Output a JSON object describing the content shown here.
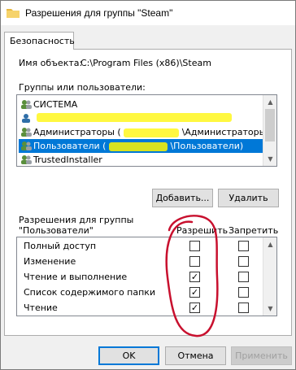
{
  "window": {
    "title": "Разрешения для группы \"Steam\""
  },
  "tabs": [
    {
      "label": "Безопасность"
    }
  ],
  "object": {
    "label": "Имя объекта:",
    "value": "C:\\Program Files (x86)\\Steam"
  },
  "groups": {
    "label": "Группы или пользователи:",
    "items": [
      {
        "label": "СИСТЕМА",
        "selected": false
      },
      {
        "label": "",
        "selected": false
      },
      {
        "label": "Администраторы (",
        "suffix": "\\Администраторы)",
        "selected": false
      },
      {
        "label": "Пользователи (",
        "suffix": "\\Пользователи)",
        "selected": true
      },
      {
        "label": "TrustedInstaller",
        "selected": false
      }
    ]
  },
  "group_buttons": {
    "add": "Добавить...",
    "remove": "Удалить"
  },
  "permissions": {
    "header_line1": "Разрешения для группы",
    "header_line2": "\"Пользователи\"",
    "allow_label": "Разрешить",
    "deny_label": "Запретить",
    "rows": [
      {
        "name": "Полный доступ",
        "allow": false,
        "deny": false
      },
      {
        "name": "Изменение",
        "allow": false,
        "deny": false
      },
      {
        "name": "Чтение и выполнение",
        "allow": true,
        "deny": false
      },
      {
        "name": "Список содержимого папки",
        "allow": true,
        "deny": false
      },
      {
        "name": "Чтение",
        "allow": true,
        "deny": false
      }
    ]
  },
  "footer": {
    "ok": "OK",
    "cancel": "Отмена",
    "apply": "Применить"
  },
  "colors": {
    "selection": "#0078d7",
    "highlight": "#fff500",
    "annotation": "#c8102e"
  }
}
